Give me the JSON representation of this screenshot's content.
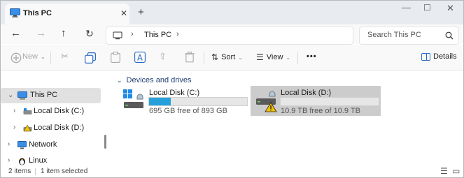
{
  "window": {
    "tab_title": "This PC",
    "colors": {
      "accent": "#26a0da",
      "folder_blue": "#1e3f74",
      "selection": "#cccccc"
    }
  },
  "address": {
    "location": "This PC"
  },
  "search": {
    "placeholder": "Search This PC"
  },
  "toolbar": {
    "new_label": "New",
    "sort_label": "Sort",
    "view_label": "View",
    "more_label": "•••",
    "details_label": "Details"
  },
  "sidebar": {
    "items": [
      {
        "label": "This PC"
      },
      {
        "label": "Local Disk (C:)"
      },
      {
        "label": "Local Disk (D:)"
      },
      {
        "label": "Network"
      },
      {
        "label": "Linux"
      }
    ]
  },
  "content": {
    "group_label": "Devices and drives",
    "drives": [
      {
        "name": "Local Disk (C:)",
        "free_text": "695 GB free of 893 GB",
        "used_fraction": 0.22
      },
      {
        "name": "Local Disk (D:)",
        "free_text": "10.9 TB free of 10.9 TB",
        "used_fraction": 0.0
      }
    ]
  },
  "status": {
    "items_count": "2 items",
    "selection": "1 item selected"
  }
}
